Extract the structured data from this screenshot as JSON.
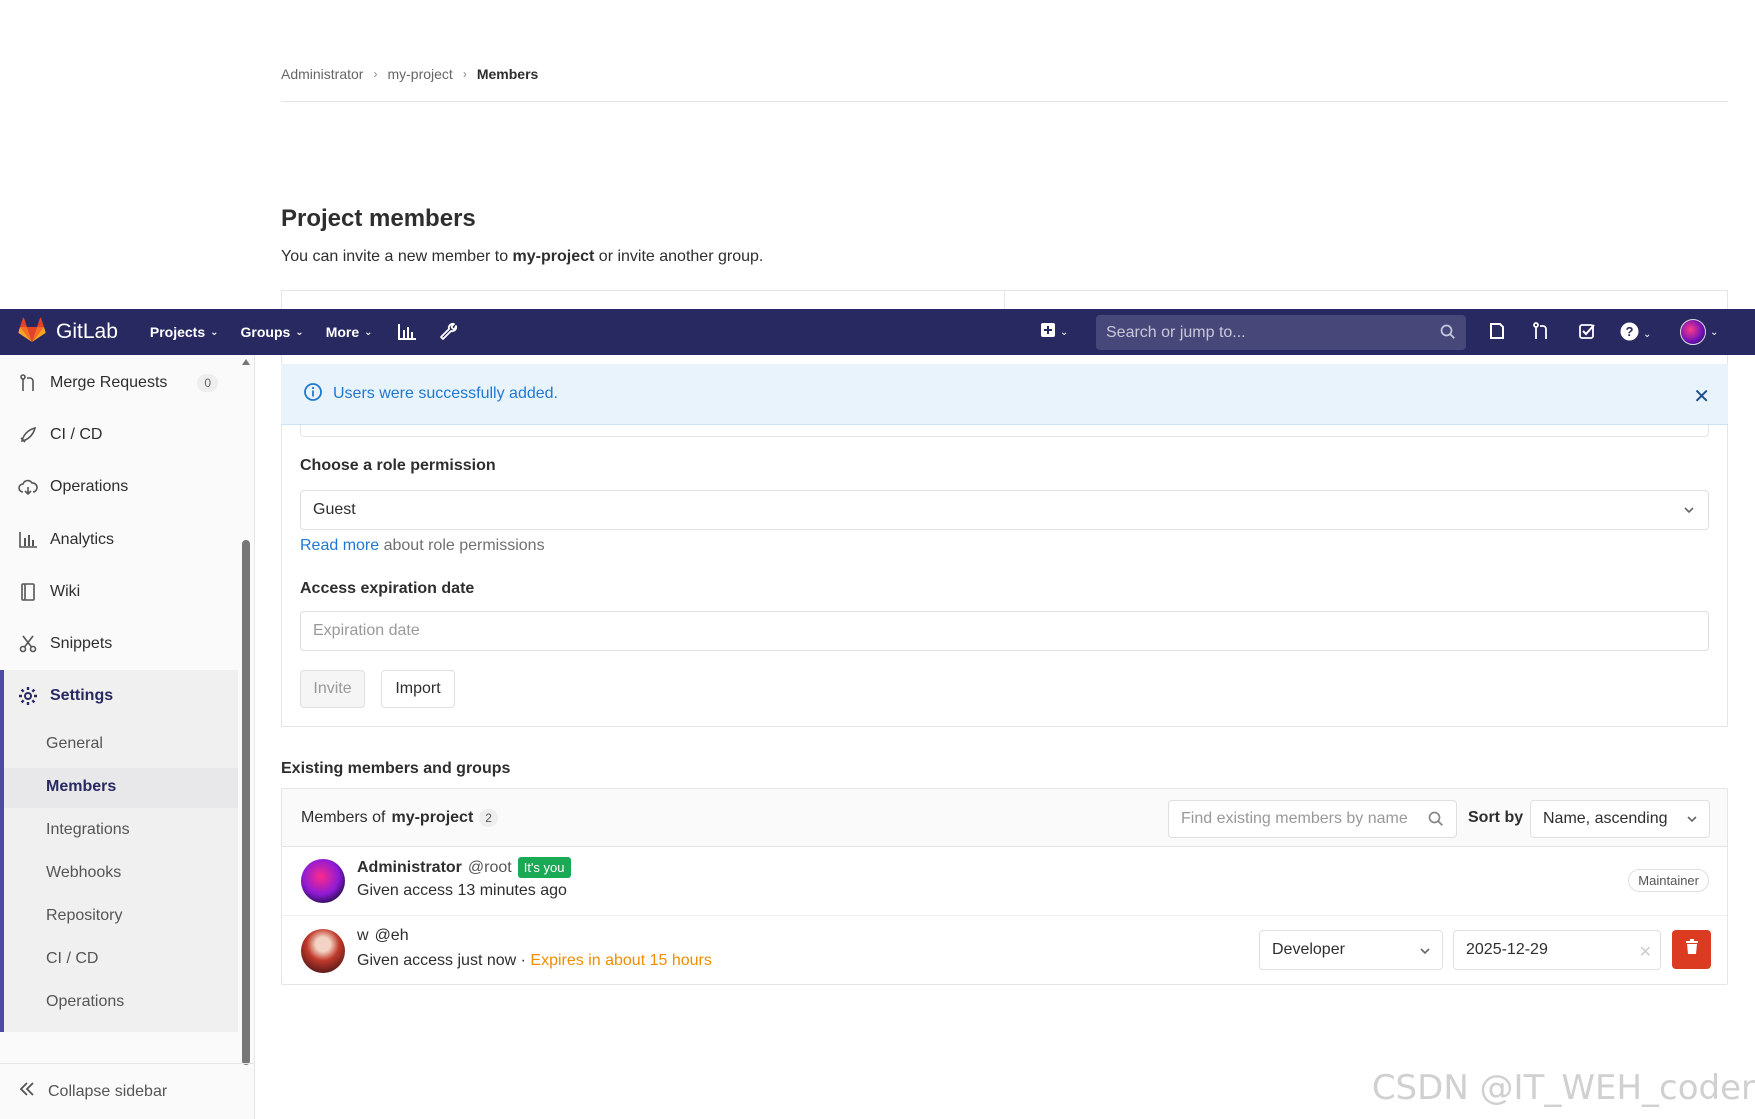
{
  "breadcrumb": {
    "items": [
      "Administrator",
      "my-project"
    ],
    "current": "Members"
  },
  "page": {
    "title": "Project members",
    "desc_prefix": "You can invite a new member to ",
    "desc_project": "my-project",
    "desc_suffix": " or invite another group."
  },
  "navbar": {
    "brand": "GitLab",
    "projects": "Projects",
    "groups": "Groups",
    "more": "More",
    "search_placeholder": "Search or jump to...",
    "brand_color": "#292961"
  },
  "sidebar": {
    "items": [
      {
        "label": "Merge Requests",
        "badge": "0",
        "icon": "merge-request-icon"
      },
      {
        "label": "CI / CD",
        "icon": "rocket-icon"
      },
      {
        "label": "Operations",
        "icon": "cloud-icon"
      },
      {
        "label": "Analytics",
        "icon": "chart-icon"
      },
      {
        "label": "Wiki",
        "icon": "book-icon"
      },
      {
        "label": "Snippets",
        "icon": "scissors-icon"
      }
    ],
    "settings": {
      "label": "Settings",
      "icon": "gear-icon"
    },
    "sub_items": [
      "General",
      "Members",
      "Integrations",
      "Webhooks",
      "Repository",
      "CI / CD",
      "Operations"
    ],
    "active_sub": "Members",
    "collapse": "Collapse sidebar"
  },
  "flash": {
    "message": "Users were successfully added."
  },
  "form": {
    "role_label": "Choose a role permission",
    "role_value": "Guest",
    "read_more": "Read more",
    "read_more_suffix": " about role permissions",
    "expiry_label": "Access expiration date",
    "expiry_placeholder": "Expiration date",
    "invite": "Invite",
    "import": "Import"
  },
  "existing": {
    "section_title": "Existing members and groups",
    "head_prefix": "Members of ",
    "head_project": "my-project",
    "count": "2",
    "find_placeholder": "Find existing members by name",
    "sort_label": "Sort by",
    "sort_value": "Name, ascending",
    "members": [
      {
        "name": "Administrator",
        "handle": "@root",
        "tag": "It's you",
        "access": "Given access 13 minutes ago",
        "role": "Maintainer"
      },
      {
        "name": "w",
        "handle": "@eh",
        "access": "Given access just now",
        "sep": " · ",
        "expires": "Expires in about 15 hours",
        "role": "Developer",
        "date": "2025-12-29"
      }
    ]
  },
  "watermark": "CSDN @IT_WEH_coder"
}
